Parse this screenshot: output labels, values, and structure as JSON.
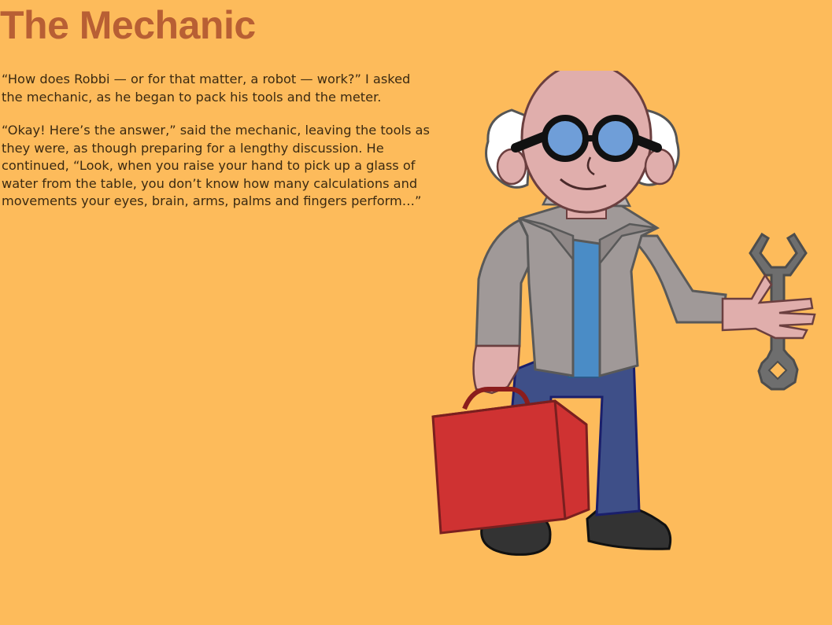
{
  "page": {
    "title": "The Mechanic",
    "paragraphs": [
      "“How does Robbi — or for that matter, a robot — work?” I asked the mechanic, as he began to pack his tools and the meter.",
      "“Okay! Here’s the answer,” said the mechanic, leaving the tools as they were, as though preparing for a lengthy discussion. He continued, “Look, when you raise your hand to pick up a glass of water from the table, you don’t know how many calculations and movements your eyes, brain, arms, palms and fingers perform…”"
    ]
  },
  "colors": {
    "background": "#FDBB5B",
    "title": "#B85F34",
    "text": "#3b2a12"
  }
}
